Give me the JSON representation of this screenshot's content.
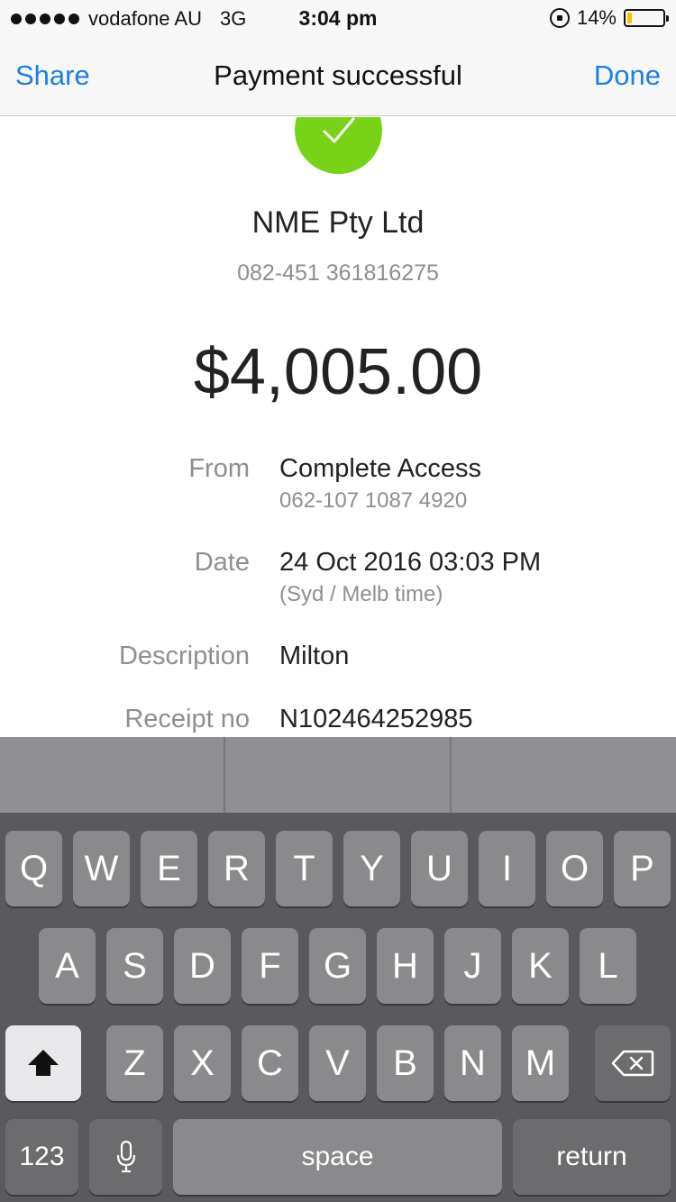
{
  "status_bar": {
    "carrier": "vodafone AU",
    "network": "3G",
    "time": "3:04 pm",
    "battery": "14%",
    "battery_level": 0.14,
    "icons": [
      "signal-dots-icon",
      "rotation-lock-icon",
      "battery-icon"
    ]
  },
  "nav": {
    "left_label": "Share",
    "title": "Payment successful",
    "right_label": "Done"
  },
  "colors": {
    "accent": "#1f7ee2",
    "success": "#78d318",
    "secondary_text": "#8e8e93",
    "battery_low": "#f5c400"
  },
  "receipt": {
    "icon": "checkmark-icon",
    "payee_name": "NME Pty Ltd",
    "payee_account": "082-451 361816275",
    "amount": "$4,005.00",
    "rows": [
      {
        "label": "From",
        "value": "Complete Access",
        "sub": "062-107 1087 4920"
      },
      {
        "label": "Date",
        "value": "24 Oct 2016 03:03 PM",
        "sub": "(Syd / Melb time)"
      },
      {
        "label": "Description",
        "value": "Milton",
        "sub": ""
      },
      {
        "label": "Receipt no",
        "value": "N102464252985",
        "sub": ""
      }
    ]
  },
  "keyboard": {
    "row1": [
      "Q",
      "W",
      "E",
      "R",
      "T",
      "Y",
      "U",
      "I",
      "O",
      "P"
    ],
    "row2": [
      "A",
      "S",
      "D",
      "F",
      "G",
      "H",
      "J",
      "K",
      "L"
    ],
    "row3": [
      "Z",
      "X",
      "C",
      "V",
      "B",
      "N",
      "M"
    ],
    "shift_icon": "shift-arrow-icon",
    "delete_icon": "backspace-icon",
    "numbers_label": "123",
    "mic_icon": "microphone-icon",
    "space_label": "space",
    "return_label": "return"
  }
}
